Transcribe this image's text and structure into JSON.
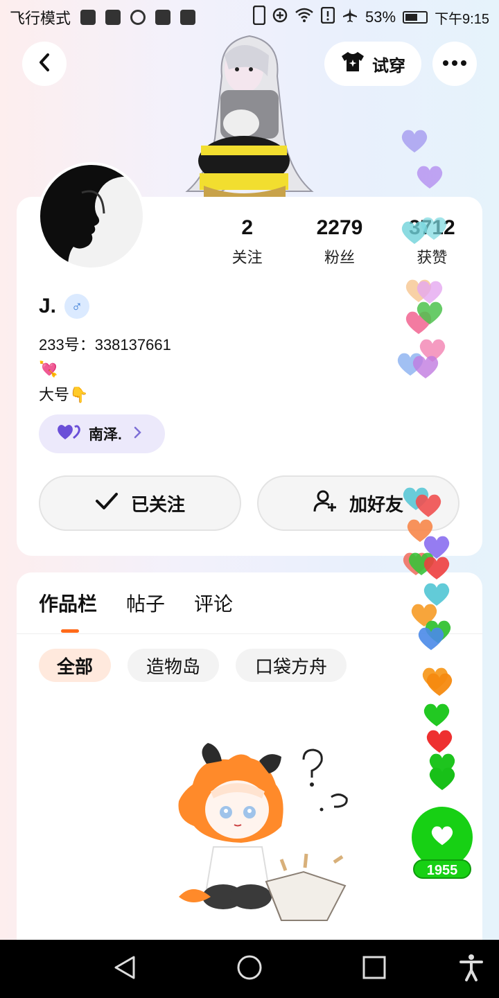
{
  "status_bar": {
    "mode": "飞行模式",
    "battery": "53%",
    "time": "下午9:15"
  },
  "header": {
    "try_on_label": "试穿",
    "back_icon": "chevron-left-icon",
    "more_icon": "more-horizontal-icon",
    "try_on_icon": "tshirt-icon"
  },
  "profile": {
    "stats": [
      {
        "value": "2",
        "label": "关注"
      },
      {
        "value": "2279",
        "label": "粉丝"
      },
      {
        "value": "3712",
        "label": "获赞"
      }
    ],
    "username": "J.",
    "gender_symbol": "♂",
    "uid": "233号：338137661",
    "bio_emoji": "💘",
    "bio": "大号👇",
    "tag_label": "南泽.",
    "follow_label": "已关注",
    "add_friend_label": "加好友"
  },
  "content": {
    "tabs": [
      {
        "label": "作品栏"
      },
      {
        "label": "帖子"
      },
      {
        "label": "评论"
      }
    ],
    "filters": [
      {
        "label": "全部"
      },
      {
        "label": "造物岛"
      },
      {
        "label": "口袋方舟"
      }
    ]
  },
  "like": {
    "count": "1955"
  },
  "colors": {
    "accent_orange": "#ff6a1a",
    "like_green": "#17d014",
    "tag_purple": "#7d6fd6"
  }
}
